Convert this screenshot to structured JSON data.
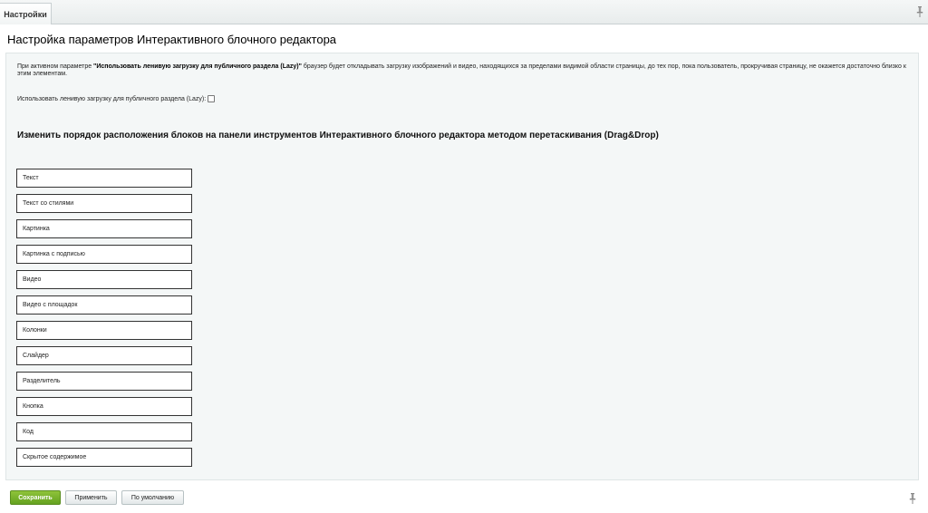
{
  "tabbar": {
    "tab_label": "Настройки"
  },
  "page": {
    "title": "Настройка параметров Интерактивного блочного редактора"
  },
  "panel": {
    "description_prefix": "При активном параметре ",
    "description_bold": "\"Использовать ленивую загрузку для публичного раздела (Lazy)\"",
    "description_suffix": " браузер будет откладывать загрузку изображений и видео, находящихся за пределами видимой области страницы, до тех пор, пока пользователь, прокручивая страницу, не окажется достаточно близко к этим элементам.",
    "lazy_label": "Использовать ленивую загрузку для публичного раздела (Lazy):",
    "lazy_checked": false,
    "section_title": "Изменить порядок расположения блоков на панели инструментов Интерактивного блочного редактора методом перетаскивания (Drag&Drop)",
    "blocks": [
      "Текст",
      "Текст со стилями",
      "Картинка",
      "Картинка с подписью",
      "Видео",
      "Видео с площадок",
      "Колонки",
      "Слайдер",
      "Разделитель",
      "Кнопка",
      "Код",
      "Скрытое содержимое"
    ]
  },
  "footer": {
    "save_label": "Сохранить",
    "apply_label": "Применить",
    "default_label": "По умолчанию"
  },
  "icons": {
    "pin_top": "pin-icon",
    "pin_bottom": "pin-icon"
  },
  "colors": {
    "save_button": "#6aa625",
    "panel_bg": "#f4f7f7"
  }
}
